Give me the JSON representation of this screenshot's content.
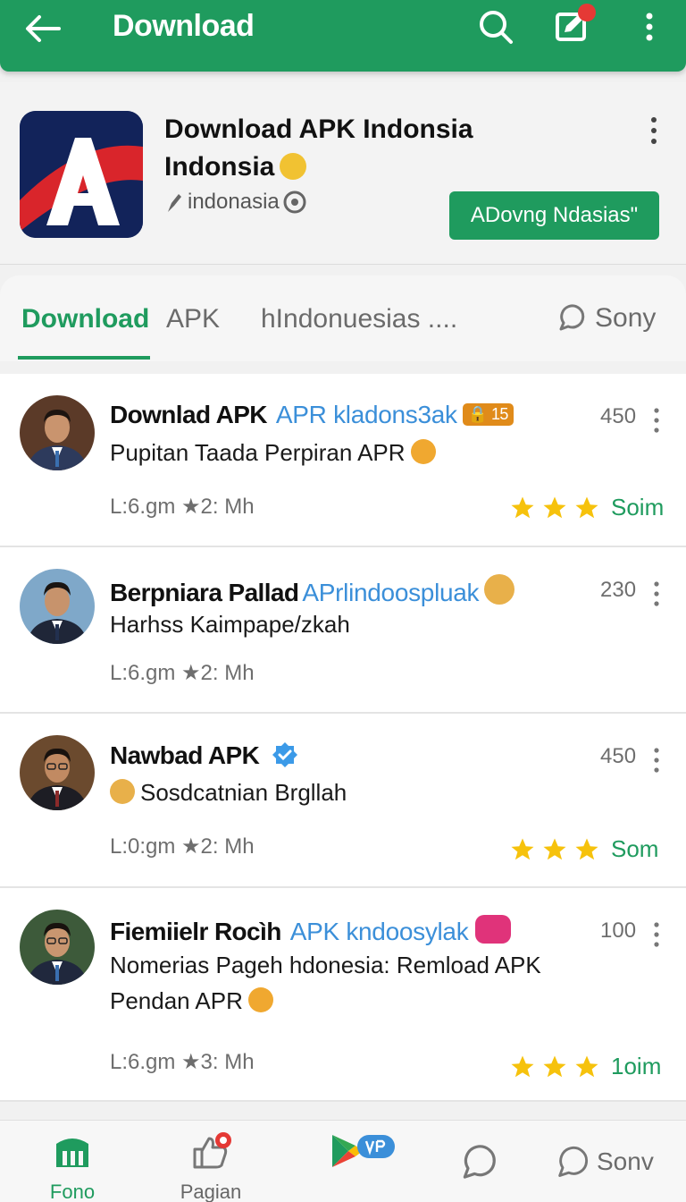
{
  "app_bar": {
    "title": "Download",
    "color": "#1f9b5e",
    "icons": [
      "back-arrow-icon",
      "search-icon",
      "compose-icon",
      "more-vertical-icon"
    ]
  },
  "app_header": {
    "name_line1": "Download APK Indonsia",
    "name_line2": "Indonsia",
    "developer": "indonasia",
    "install_label": "ADovng Ndasias\""
  },
  "tabs": {
    "items": [
      "Download",
      "APK",
      "hIndonuesias ...."
    ],
    "active": "Download",
    "right_label": "Sony"
  },
  "posts": [
    {
      "name": "Downlad APK",
      "tag": "APR kladons3ak",
      "badge": "15",
      "text": "Pupitan Taada Perpiran APR",
      "meta": "L:6.gm ★2: Mh",
      "count": "450",
      "stars": 3,
      "rating_label": "Soim"
    },
    {
      "name": "Berpniara Pallad",
      "tag": "APrlindoospluak",
      "text": "Harhss Kaimpape/zkah",
      "meta": "L:6.gm ★2: Mh",
      "count": "230"
    },
    {
      "name": "Nawbad APK",
      "text": "Sosdcatnian Brgllah",
      "meta": "L:0:gm ★2: Mh",
      "count": "450",
      "stars": 3,
      "rating_label": "Som"
    },
    {
      "name": "Fiemiielr Rocìh",
      "tag": "APK kndoosylak",
      "text_line1": "Nomerias Pageh hdonesia: Remload APK",
      "text_line2": "Pendan APR",
      "meta": "L:6.gm ★3: Mh",
      "count": "100",
      "stars": 3,
      "rating_label": "1oim"
    }
  ],
  "bottom_nav": {
    "items": [
      "Fono",
      "Pagian"
    ],
    "right_label": "Sonv"
  }
}
